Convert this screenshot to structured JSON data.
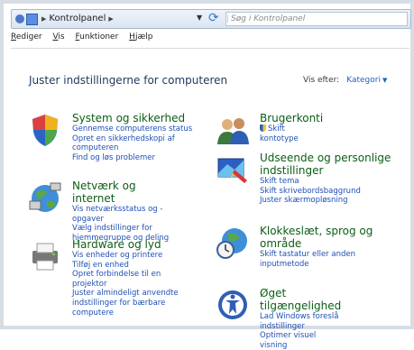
{
  "address_bar": {
    "breadcrumb": "Kontrolpanel",
    "search_placeholder": "Søg i Kontrolpanel"
  },
  "menu": [
    "Rediger",
    "Vis",
    "Funktioner",
    "Hjælp"
  ],
  "heading": "Juster indstillingerne for computeren",
  "view_by": {
    "label": "Vis efter:",
    "value": "Kategori"
  },
  "categories": [
    {
      "title": "System og sikkerhed",
      "links": [
        "Gennemse computerens status",
        "Opret en sikkerhedskopi af computeren",
        "Find og løs problemer"
      ],
      "icon": "shield-icon"
    },
    {
      "title": "Netværk og internet",
      "links": [
        "Vis netværksstatus og -opgaver",
        "Vælg indstillinger for hjemmegruppe og deling"
      ],
      "icon": "globe-network-icon"
    },
    {
      "title": "Hardware og lyd",
      "links": [
        "Vis enheder og printere",
        "Tilføj en enhed",
        "Opret forbindelse til en projektor",
        "Juster almindeligt anvendte indstillinger for bærbare computere"
      ],
      "icon": "printer-icon"
    },
    {
      "title": "Brugerkonti",
      "links": [
        "Skift kontotype"
      ],
      "icon": "users-icon"
    },
    {
      "title": "Udseende og personlige indstillinger",
      "links": [
        "Skift tema",
        "Skift skrivebordsbaggrund",
        "Juster skærmopløsning"
      ],
      "icon": "appearance-icon"
    },
    {
      "title": "Klokkeslæt, sprog og område",
      "links": [
        "Skift tastatur eller anden inputmetode"
      ],
      "icon": "clock-globe-icon"
    },
    {
      "title": "Øget tilgængelighed",
      "links": [
        "Lad Windows foreslå indstillinger",
        "Optimer visuel visning"
      ],
      "icon": "accessibility-icon"
    }
  ]
}
